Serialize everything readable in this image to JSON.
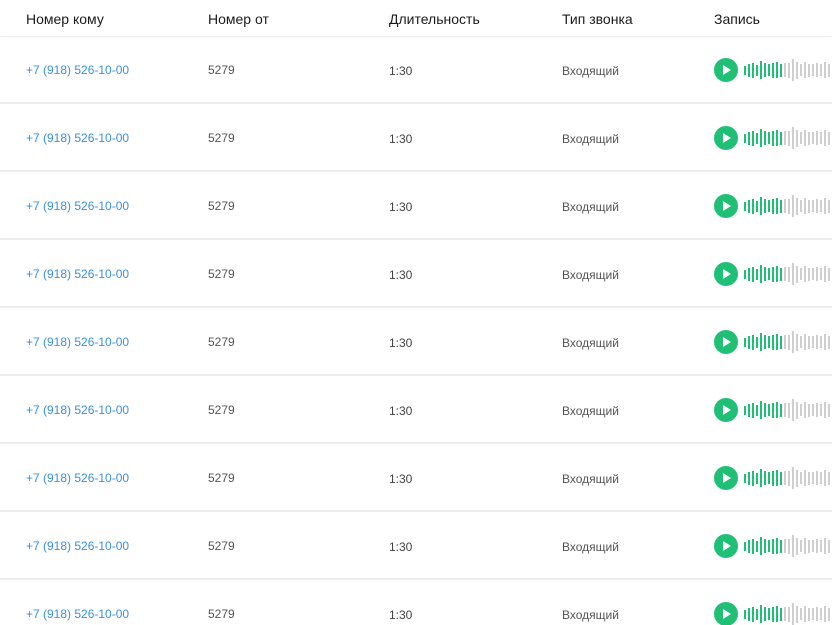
{
  "columns": {
    "to": "Номер кому",
    "from": "Номер от",
    "duration": "Длительность",
    "type": "Тип звонка",
    "record": "Запись"
  },
  "colors": {
    "played": "#1fbf75",
    "unplayed": "#cfcfcf",
    "link": "#3a8fdd"
  },
  "rows": [
    {
      "to": "+7 (918) 526-10-00",
      "from": "5279",
      "duration": "1:30",
      "type": "Входящий",
      "progress": 0.45
    },
    {
      "to": "+7 (918) 526-10-00",
      "from": "5279",
      "duration": "1:30",
      "type": "Входящий",
      "progress": 0.45
    },
    {
      "to": "+7 (918) 526-10-00",
      "from": "5279",
      "duration": "1:30",
      "type": "Входящий",
      "progress": 0.45
    },
    {
      "to": "+7 (918) 526-10-00",
      "from": "5279",
      "duration": "1:30",
      "type": "Входящий",
      "progress": 0.45
    },
    {
      "to": "+7 (918) 526-10-00",
      "from": "5279",
      "duration": "1:30",
      "type": "Входящий",
      "progress": 0.45
    },
    {
      "to": "+7 (918) 526-10-00",
      "from": "5279",
      "duration": "1:30",
      "type": "Входящий",
      "progress": 0.45
    },
    {
      "to": "+7 (918) 526-10-00",
      "from": "5279",
      "duration": "1:30",
      "type": "Входящий",
      "progress": 0.45
    },
    {
      "to": "+7 (918) 526-10-00",
      "from": "5279",
      "duration": "1:30",
      "type": "Входящий",
      "progress": 0.45
    },
    {
      "to": "+7 (918) 526-10-00",
      "from": "5279",
      "duration": "1:30",
      "type": "Входящий",
      "progress": 0.45
    }
  ],
  "icons": {
    "play": "play-icon",
    "waveform": "waveform-icon"
  }
}
